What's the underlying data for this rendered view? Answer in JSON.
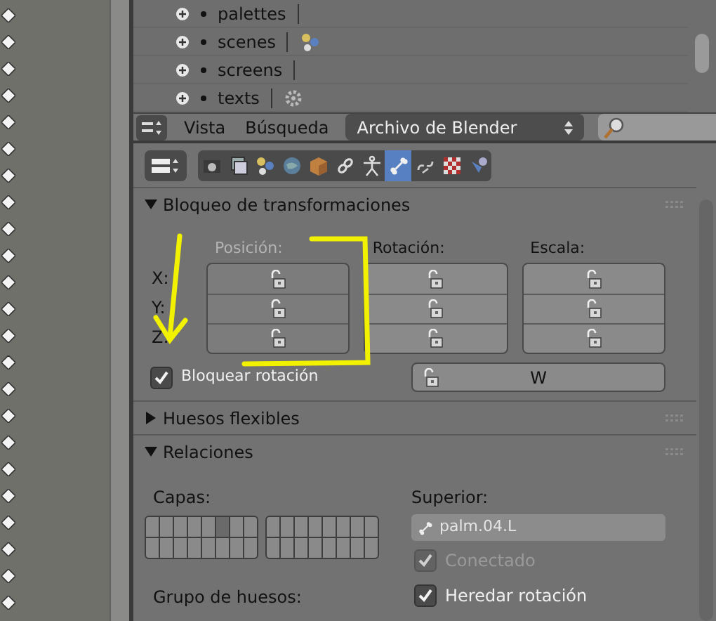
{
  "outliner": {
    "rows": [
      {
        "name": "palettes",
        "kind": "none"
      },
      {
        "name": "scenes",
        "kind": "scene"
      },
      {
        "name": "screens",
        "kind": "none"
      },
      {
        "name": "texts",
        "kind": "gear"
      }
    ]
  },
  "header": {
    "menus": [
      "Vista",
      "Búsqueda"
    ],
    "display_mode": "Archivo de Blender"
  },
  "property_tabs": [
    {
      "kind": "camera",
      "selected": false
    },
    {
      "kind": "layers",
      "selected": false
    },
    {
      "kind": "scene",
      "selected": false
    },
    {
      "kind": "world",
      "selected": false
    },
    {
      "kind": "cube",
      "selected": false
    },
    {
      "kind": "link",
      "selected": false
    },
    {
      "kind": "figure",
      "selected": false
    },
    {
      "kind": "bone",
      "selected": true
    },
    {
      "kind": "bone-link",
      "selected": false
    },
    {
      "kind": "checker",
      "selected": false
    },
    {
      "kind": "brush",
      "selected": false
    }
  ],
  "transform_locks": {
    "title": "Bloqueo de transformaciones",
    "expanded": true,
    "axes": [
      "X:",
      "Y:",
      "Z:"
    ],
    "columns": [
      {
        "label": "Posición:",
        "disabled": true,
        "locks": [
          {
            "locked": false
          },
          {
            "locked": false
          },
          {
            "locked": false
          }
        ]
      },
      {
        "label": "Rotación:",
        "disabled": false,
        "locks": [
          {
            "locked": false
          },
          {
            "locked": false
          },
          {
            "locked": false
          }
        ]
      },
      {
        "label": "Escala:",
        "disabled": false,
        "locks": [
          {
            "locked": false
          },
          {
            "locked": false
          },
          {
            "locked": false
          }
        ]
      }
    ],
    "lock_rotation": {
      "label": "Bloquear rotación",
      "checked": true
    },
    "w_lock": {
      "label": "W",
      "locked": false
    }
  },
  "bendy_bones": {
    "title": "Huesos flexibles",
    "expanded": false
  },
  "relations": {
    "title": "Relaciones",
    "expanded": true,
    "layers_label": "Capas:",
    "layer_blocks": [
      {
        "cells": [
          {
            "selected": false
          },
          {
            "selected": false
          },
          {
            "selected": false
          },
          {
            "selected": false
          },
          {
            "selected": false
          },
          {
            "selected": true
          },
          {
            "selected": false
          },
          {
            "selected": false
          },
          {
            "selected": false
          },
          {
            "selected": false
          },
          {
            "selected": false
          },
          {
            "selected": false
          },
          {
            "selected": false
          },
          {
            "selected": false
          },
          {
            "selected": false
          },
          {
            "selected": false
          }
        ]
      },
      {
        "cells": [
          {
            "selected": false
          },
          {
            "selected": false
          },
          {
            "selected": false
          },
          {
            "selected": false
          },
          {
            "selected": false
          },
          {
            "selected": false
          },
          {
            "selected": false
          },
          {
            "selected": false
          },
          {
            "selected": false
          },
          {
            "selected": false
          },
          {
            "selected": false
          },
          {
            "selected": false
          },
          {
            "selected": false
          },
          {
            "selected": false
          },
          {
            "selected": false
          },
          {
            "selected": false
          }
        ]
      }
    ],
    "parent_label": "Superior:",
    "parent_value": "palm.04.L",
    "connected": {
      "label": "Conectado",
      "checked": true,
      "disabled": true
    },
    "inherit_rotation": {
      "label": "Heredar rotación",
      "checked": true,
      "disabled": false
    },
    "bone_group_label": "Grupo de huesos:"
  }
}
